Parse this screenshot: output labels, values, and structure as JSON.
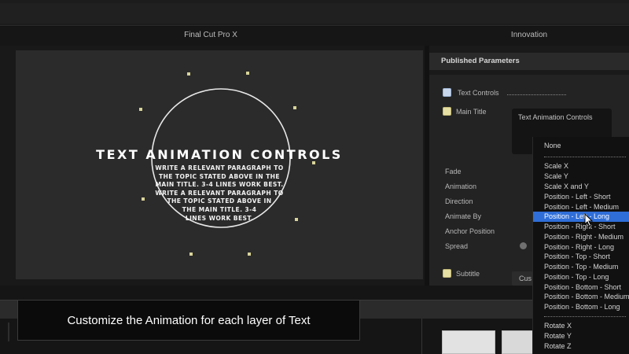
{
  "app": {
    "title": "Final Cut Pro X",
    "inspector_title": "Innovation"
  },
  "viewer": {
    "heading": "TEXT ANIMATION CONTROLS",
    "body_lines": [
      "WRITE A RELEVANT PARAGRAPH TO",
      "THE TOPIC STATED ABOVE IN THE",
      "MAIN TITLE. 3-4 LINES WORK BEST.",
      "WRITE A RELEVANT PARAGRAPH TO",
      "THE TOPIC STATED ABOVE IN",
      "THE MAIN TITLE. 3-4",
      "LINES WORK BEST."
    ]
  },
  "inspector": {
    "header": "Published Parameters",
    "text_controls": "Text Controls",
    "main_title": "Main Title",
    "text_animation_controls": "Text Animation Controls",
    "params": [
      "Fade",
      "Animation",
      "Direction",
      "Animate By",
      "Anchor Position",
      "Spread"
    ],
    "subtitle": "Subtitle",
    "cus_button": "Cus"
  },
  "dropdown": {
    "selected": "Position - Left - Long",
    "groups": [
      [
        "None"
      ],
      [
        "Scale X",
        "Scale Y",
        "Scale X and Y",
        "Position - Left - Short",
        "Position - Left - Medium",
        "Position - Left - Long",
        "Position - Right - Short",
        "Position - Right - Medium",
        "Position - Right - Long",
        "Position - Top - Short",
        "Position - Top - Medium",
        "Position - Top - Long",
        "Position - Bottom - Short",
        "Position - Bottom - Medium",
        "Position - Bottom - Long"
      ],
      [
        "Rotate X",
        "Rotate Y",
        "Rotate Z"
      ]
    ]
  },
  "caption": "Customize the Animation for each layer of Text",
  "icons": [
    "text-controls-checkbox-icon",
    "main-title-note-icon",
    "subtitle-note-icon",
    "mouse-cursor-icon"
  ],
  "colors": {
    "selection": "#2f6ed8",
    "viewer_bg": "#2b2b2b",
    "star": "#d8d49a"
  }
}
